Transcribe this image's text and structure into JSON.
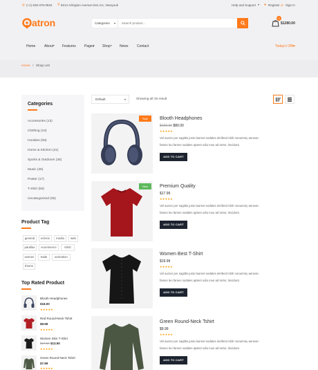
{
  "topbar": {
    "phone": "(+1) 828-376-0532",
    "address": "8214 Arlington Avenue Des Arc, Newyouk",
    "help_support": "Help and Support",
    "register": "Register",
    "or": "or",
    "signin": "Sign in"
  },
  "logo": {
    "text": "atron"
  },
  "search": {
    "category": "Categories",
    "placeholder": "Search product..."
  },
  "cart": {
    "count": "0",
    "total": "$1280.00"
  },
  "nav": {
    "items": [
      "Home",
      "About",
      "Features",
      "Pages",
      "Shop",
      "News",
      "Contact"
    ],
    "offer": "Today's Offer"
  },
  "breadcrumb": {
    "home": "Home",
    "sep": "/",
    "current": "Shop List"
  },
  "sidebar": {
    "categories_title": "Categories",
    "categories": [
      "Accessories (13)",
      "Clothing (10)",
      "Hoodies (09)",
      "Home & Kitchen (21)",
      "Sports & Outdoors (35)",
      "Music (25)",
      "Poster (17)",
      "T-Shirt (50)",
      "Uncategorized (05)"
    ],
    "tag_title": "Product Tag",
    "tags": [
      "general",
      "eclecix",
      "media",
      "web",
      "parallax",
      "ecommerce",
      "tshirt",
      "women",
      "trade",
      "animation",
      "theme"
    ],
    "top_rated_title": "Top Rated Product",
    "top_rated": [
      {
        "name": "Blooth Headphones",
        "price": "$18.00",
        "old": ""
      },
      {
        "name": "Red Round-Neck Tshirt",
        "price": "$9.99",
        "old": ""
      },
      {
        "name": "Women Skin T-Shirt",
        "price": "$13.50",
        "old": "$17.50"
      },
      {
        "name": "Green Round-Neck Tshirt",
        "price": "$7.99",
        "old": ""
      }
    ],
    "stars": "★★★★★"
  },
  "toolbar": {
    "sort": "Default",
    "showing": "Showing all 15 result"
  },
  "products": [
    {
      "title": "Blooth Headphones",
      "old": "$100.00",
      "price": "$80.00",
      "badge": "Sale",
      "badge_color": "#ff7a1a"
    },
    {
      "title": "Premium Quality",
      "old": "",
      "price": "$17.99",
      "badge": "New",
      "badge_color": "#5cb85c"
    },
    {
      "title": "Women Best T-Shirt",
      "old": "",
      "price": "$19.99",
      "badge": "",
      "badge_color": ""
    },
    {
      "title": "Green Round-Neck Tshirt",
      "old": "",
      "price": "$9.99",
      "badge": "",
      "badge_color": ""
    }
  ],
  "product_desc_1": "Vel auctor per sagittis justo laoreet sodales eleifend nibh nonummy aenean",
  "product_desc_2": "fames leo fames sodales aptent odio mus ad tortor, tincidunt.",
  "add_to_cart": "ADD TO CART",
  "colors": {
    "accent": "#ff7a1a",
    "dark": "#1d2430",
    "star": "#ff9a00"
  }
}
